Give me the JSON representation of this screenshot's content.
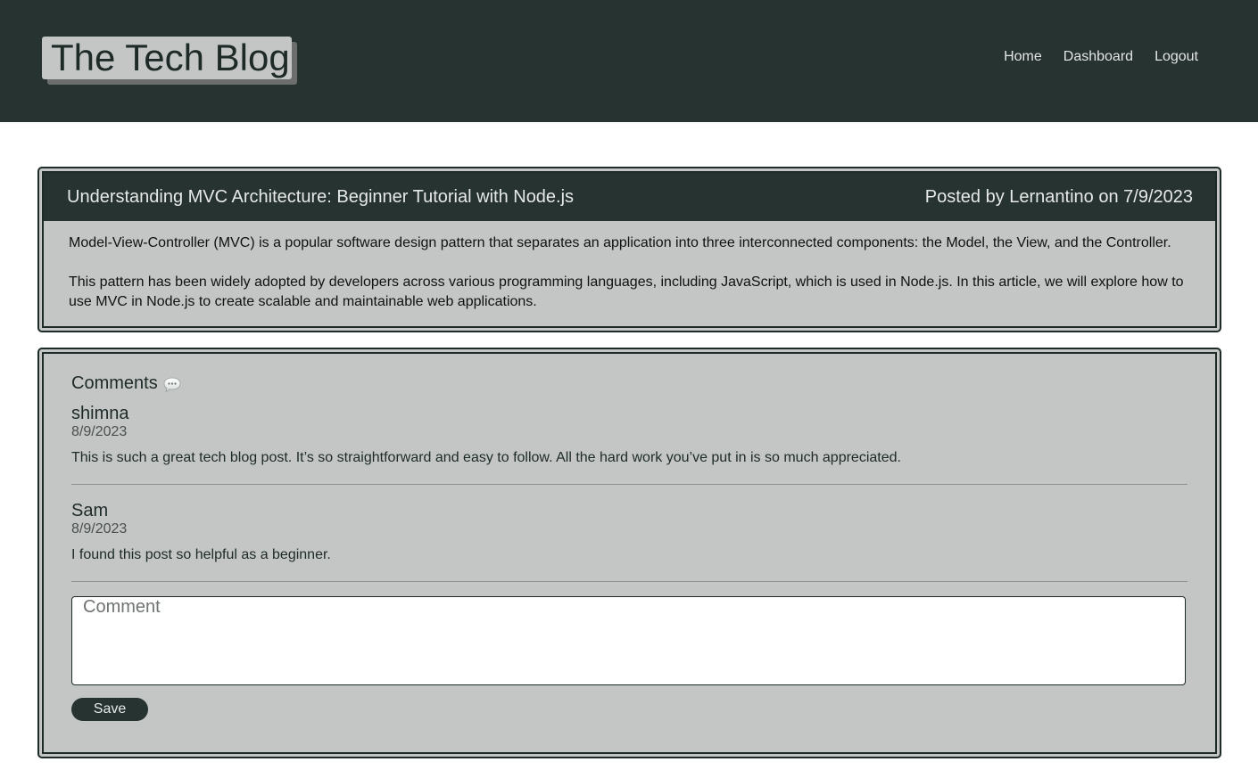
{
  "header": {
    "brand": "The Tech Blog",
    "nav": [
      {
        "label": "Home"
      },
      {
        "label": "Dashboard"
      },
      {
        "label": "Logout"
      }
    ]
  },
  "post": {
    "title": "Understanding MVC Architecture: Beginner Tutorial with Node.js",
    "byline": "Posted by Lernantino on 7/9/2023",
    "paragraphs": [
      "Model-View-Controller (MVC) is a popular software design pattern that separates an application into three interconnected components: the Model, the View, and the Controller.",
      "This pattern has been widely adopted by developers across various programming languages, including JavaScript, which is used in Node.js. In this article, we will explore how to use MVC in Node.js to create scalable and maintainable web applications."
    ]
  },
  "comments": {
    "title": "Comments",
    "icon": "speech-bubble-icon",
    "items": [
      {
        "author": "shimna",
        "date": "8/9/2023",
        "text": "This is such a great tech blog post. It’s so straightforward and easy to follow. All the hard work you’ve put in is so much appreciated."
      },
      {
        "author": "Sam",
        "date": "8/9/2023",
        "text": "I found this post so helpful as a beginner."
      }
    ],
    "input": {
      "placeholder": "Comment",
      "value": ""
    },
    "save_label": "Save"
  },
  "colors": {
    "header_bg": "#263331",
    "card_bg": "#c3c6c5",
    "text_dark": "#1e2a28"
  }
}
